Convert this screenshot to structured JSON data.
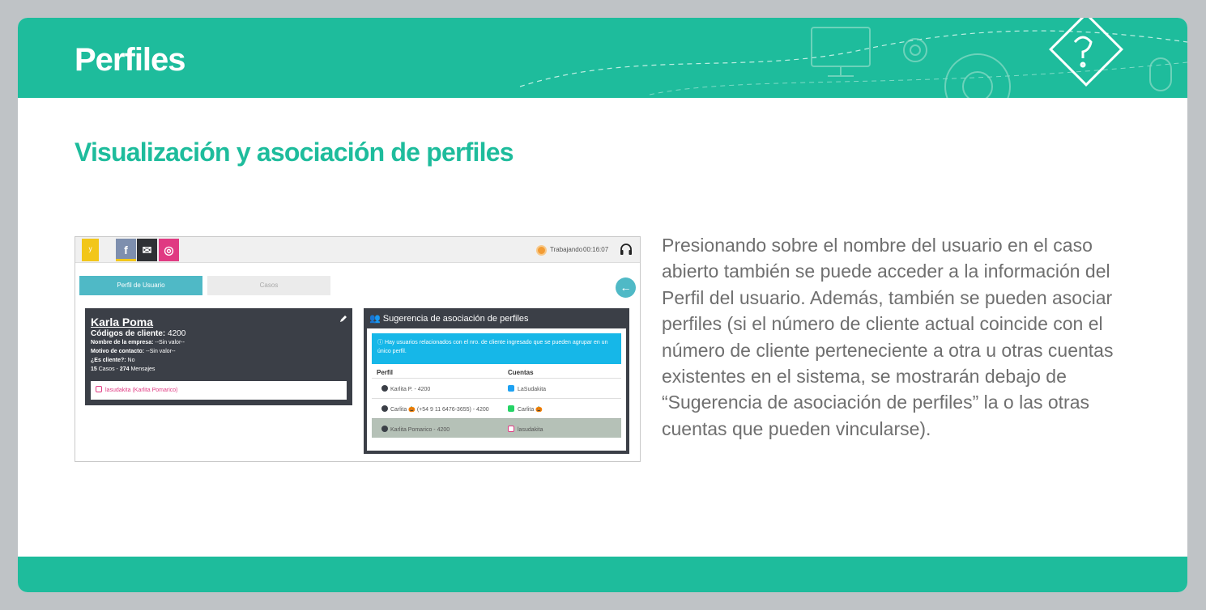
{
  "header": {
    "title": "Perfiles"
  },
  "section": {
    "subtitle": "Visualización y asociación de perfiles"
  },
  "description": "Presionando sobre el nombre del usuario en el caso abierto también se puede acceder a la información del Perfil del usuario. Además, también se pueden asociar perfiles (si el número de cliente actual coincide con el número de cliente perteneciente a otra u otras cuentas existentes en el sistema, se mostrarán debajo de “Sugerencia de asociación de perfiles” la o las otras cuentas que pueden vincularse).",
  "colors": {
    "brand": "#1ebc9c",
    "card": "#3b3f47",
    "accent": "#4fb9c6",
    "alert": "#16b7e8",
    "instagram": "#e03a82"
  },
  "screenshot": {
    "topbar": {
      "channels": [
        {
          "name": "facebook",
          "icon": "facebook-icon",
          "glyph": "f"
        },
        {
          "name": "email",
          "icon": "mail-icon",
          "glyph": "✉"
        },
        {
          "name": "instagram",
          "icon": "instagram-icon",
          "glyph": "◎"
        }
      ],
      "status_label": "Trabajando",
      "status_time": "00:16:07"
    },
    "tabs": {
      "profile": "Perfil de Usuario",
      "cases": "Casos"
    },
    "back_glyph": "←",
    "profile_card": {
      "name": "Karla Poma",
      "codes_label": "Códigos de cliente:",
      "codes_value": "4200",
      "company_label": "Nombre de la empresa:",
      "company_value": "--Sin valor--",
      "reason_label": "Motivo de contacto:",
      "reason_value": "--Sin valor--",
      "client_label": "¿Es cliente?:",
      "client_value": "No",
      "cases_count": "15",
      "cases_label": "Casos -",
      "messages_count": "274",
      "messages_label": "Mensajes",
      "social_account": "lasudakita (Karlita Pomarico)"
    },
    "suggestion": {
      "title": "Sugerencia de asociación de perfiles",
      "alert": "Hay usuarios relacionados con el nro. de cliente ingresado que se pueden agrupar en un único perfil.",
      "col_profile": "Perfil",
      "col_accounts": "Cuentas",
      "rows": [
        {
          "profile": "Karlita P. - 4200",
          "account": "LaSudakita",
          "account_color": "#1da1f2"
        },
        {
          "profile": "Carlita 🎃 (+54 9 11 6476-3655) - 4200",
          "account": "Carlita 🎃",
          "account_color": "#25d366"
        },
        {
          "profile": "Karlita Pomarico - 4200",
          "account": "lasudakita",
          "account_color": "#e03a82"
        }
      ]
    }
  }
}
